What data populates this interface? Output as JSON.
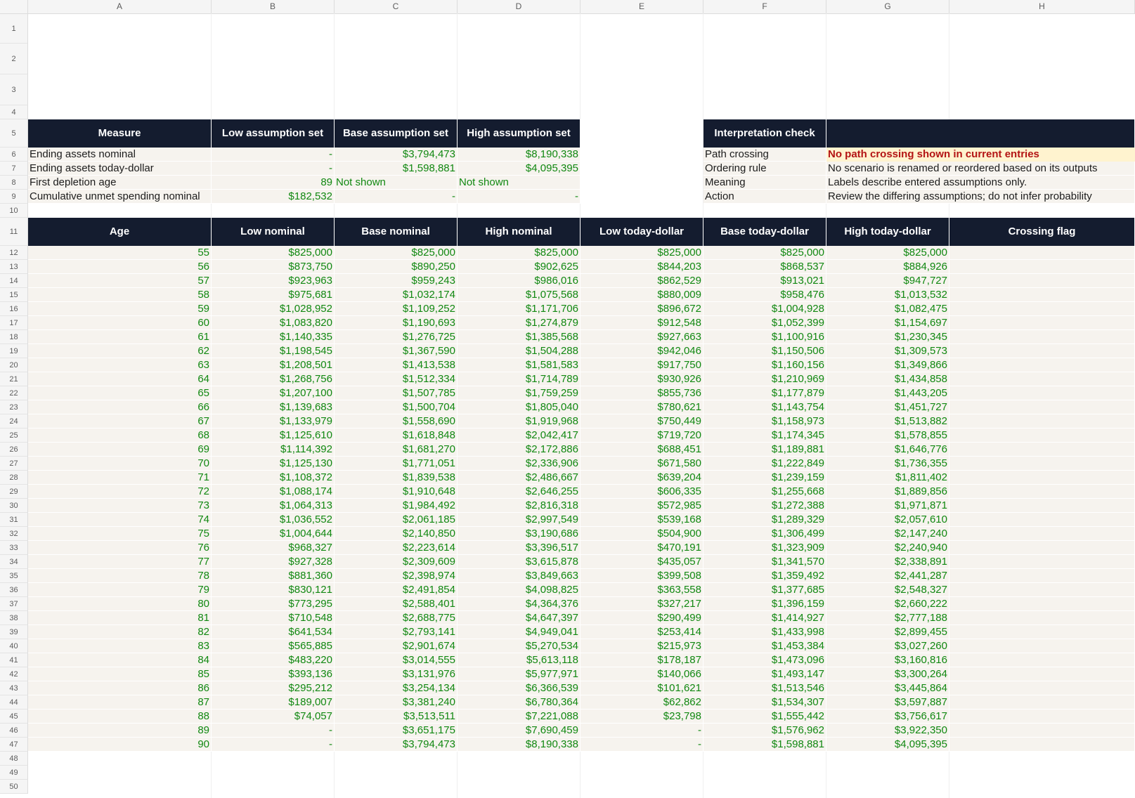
{
  "columns": [
    "A",
    "B",
    "C",
    "D",
    "E",
    "F",
    "G",
    "H"
  ],
  "row_numbers": [
    1,
    2,
    3,
    4,
    5,
    6,
    7,
    8,
    9,
    10,
    11,
    12,
    13,
    14,
    15,
    16,
    17,
    18,
    19,
    20,
    21,
    22,
    23,
    24,
    25,
    26,
    27,
    28,
    29,
    30,
    31,
    32,
    33,
    34,
    35,
    36,
    37,
    38,
    39,
    40,
    41,
    42,
    43,
    44,
    45,
    46,
    47,
    48,
    49,
    50
  ],
  "summary": {
    "headers": [
      "Measure",
      "Low assumption set",
      "Base assumption set",
      "High assumption set"
    ],
    "rows": [
      {
        "measure": "Ending assets nominal",
        "low": "-",
        "base": "$3,794,473",
        "high": "$8,190,338"
      },
      {
        "measure": "Ending assets today-dollar",
        "low": "-",
        "base": "$1,598,881",
        "high": "$4,095,395"
      },
      {
        "measure": "First depletion age",
        "low": "89",
        "base": "Not shown",
        "high": "Not shown"
      },
      {
        "measure": "Cumulative unmet spending nominal",
        "low": "$182,532",
        "base": "-",
        "high": "-"
      }
    ]
  },
  "interpretation": {
    "headers": [
      "Interpretation check",
      ""
    ],
    "rows": [
      {
        "label": "Path crossing",
        "value": "No path crossing shown in current entries"
      },
      {
        "label": "Ordering rule",
        "value": "No scenario is renamed or reordered based on its outputs"
      },
      {
        "label": "Meaning",
        "value": "Labels describe entered assumptions only."
      },
      {
        "label": "Action",
        "value": "Review the differing assumptions; do not infer probability"
      }
    ]
  },
  "paths": {
    "headers": [
      "Age",
      "Low nominal",
      "Base nominal",
      "High nominal",
      "Low today-dollar",
      "Base today-dollar",
      "High today-dollar",
      "Crossing flag"
    ],
    "rows": [
      [
        "55",
        "$825,000",
        "$825,000",
        "$825,000",
        "$825,000",
        "$825,000",
        "$825,000",
        ""
      ],
      [
        "56",
        "$873,750",
        "$890,250",
        "$902,625",
        "$844,203",
        "$868,537",
        "$884,926",
        ""
      ],
      [
        "57",
        "$923,963",
        "$959,243",
        "$986,016",
        "$862,529",
        "$913,021",
        "$947,727",
        ""
      ],
      [
        "58",
        "$975,681",
        "$1,032,174",
        "$1,075,568",
        "$880,009",
        "$958,476",
        "$1,013,532",
        ""
      ],
      [
        "59",
        "$1,028,952",
        "$1,109,252",
        "$1,171,706",
        "$896,672",
        "$1,004,928",
        "$1,082,475",
        ""
      ],
      [
        "60",
        "$1,083,820",
        "$1,190,693",
        "$1,274,879",
        "$912,548",
        "$1,052,399",
        "$1,154,697",
        ""
      ],
      [
        "61",
        "$1,140,335",
        "$1,276,725",
        "$1,385,568",
        "$927,663",
        "$1,100,916",
        "$1,230,345",
        ""
      ],
      [
        "62",
        "$1,198,545",
        "$1,367,590",
        "$1,504,288",
        "$942,046",
        "$1,150,506",
        "$1,309,573",
        ""
      ],
      [
        "63",
        "$1,208,501",
        "$1,413,538",
        "$1,581,583",
        "$917,750",
        "$1,160,156",
        "$1,349,866",
        ""
      ],
      [
        "64",
        "$1,268,756",
        "$1,512,334",
        "$1,714,789",
        "$930,926",
        "$1,210,969",
        "$1,434,858",
        ""
      ],
      [
        "65",
        "$1,207,100",
        "$1,507,785",
        "$1,759,259",
        "$855,736",
        "$1,177,879",
        "$1,443,205",
        ""
      ],
      [
        "66",
        "$1,139,683",
        "$1,500,704",
        "$1,805,040",
        "$780,621",
        "$1,143,754",
        "$1,451,727",
        ""
      ],
      [
        "67",
        "$1,133,979",
        "$1,558,690",
        "$1,919,968",
        "$750,449",
        "$1,158,973",
        "$1,513,882",
        ""
      ],
      [
        "68",
        "$1,125,610",
        "$1,618,848",
        "$2,042,417",
        "$719,720",
        "$1,174,345",
        "$1,578,855",
        ""
      ],
      [
        "69",
        "$1,114,392",
        "$1,681,270",
        "$2,172,886",
        "$688,451",
        "$1,189,881",
        "$1,646,776",
        ""
      ],
      [
        "70",
        "$1,125,130",
        "$1,771,051",
        "$2,336,906",
        "$671,580",
        "$1,222,849",
        "$1,736,355",
        ""
      ],
      [
        "71",
        "$1,108,372",
        "$1,839,538",
        "$2,486,667",
        "$639,204",
        "$1,239,159",
        "$1,811,402",
        ""
      ],
      [
        "72",
        "$1,088,174",
        "$1,910,648",
        "$2,646,255",
        "$606,335",
        "$1,255,668",
        "$1,889,856",
        ""
      ],
      [
        "73",
        "$1,064,313",
        "$1,984,492",
        "$2,816,318",
        "$572,985",
        "$1,272,388",
        "$1,971,871",
        ""
      ],
      [
        "74",
        "$1,036,552",
        "$2,061,185",
        "$2,997,549",
        "$539,168",
        "$1,289,329",
        "$2,057,610",
        ""
      ],
      [
        "75",
        "$1,004,644",
        "$2,140,850",
        "$3,190,686",
        "$504,900",
        "$1,306,499",
        "$2,147,240",
        ""
      ],
      [
        "76",
        "$968,327",
        "$2,223,614",
        "$3,396,517",
        "$470,191",
        "$1,323,909",
        "$2,240,940",
        ""
      ],
      [
        "77",
        "$927,328",
        "$2,309,609",
        "$3,615,878",
        "$435,057",
        "$1,341,570",
        "$2,338,891",
        ""
      ],
      [
        "78",
        "$881,360",
        "$2,398,974",
        "$3,849,663",
        "$399,508",
        "$1,359,492",
        "$2,441,287",
        ""
      ],
      [
        "79",
        "$830,121",
        "$2,491,854",
        "$4,098,825",
        "$363,558",
        "$1,377,685",
        "$2,548,327",
        ""
      ],
      [
        "80",
        "$773,295",
        "$2,588,401",
        "$4,364,376",
        "$327,217",
        "$1,396,159",
        "$2,660,222",
        ""
      ],
      [
        "81",
        "$710,548",
        "$2,688,775",
        "$4,647,397",
        "$290,499",
        "$1,414,927",
        "$2,777,188",
        ""
      ],
      [
        "82",
        "$641,534",
        "$2,793,141",
        "$4,949,041",
        "$253,414",
        "$1,433,998",
        "$2,899,455",
        ""
      ],
      [
        "83",
        "$565,885",
        "$2,901,674",
        "$5,270,534",
        "$215,973",
        "$1,453,384",
        "$3,027,260",
        ""
      ],
      [
        "84",
        "$483,220",
        "$3,014,555",
        "$5,613,118",
        "$178,187",
        "$1,473,096",
        "$3,160,816",
        ""
      ],
      [
        "85",
        "$393,136",
        "$3,131,976",
        "$5,977,971",
        "$140,066",
        "$1,493,147",
        "$3,300,264",
        ""
      ],
      [
        "86",
        "$295,212",
        "$3,254,134",
        "$6,366,539",
        "$101,621",
        "$1,513,546",
        "$3,445,864",
        ""
      ],
      [
        "87",
        "$189,007",
        "$3,381,240",
        "$6,780,364",
        "$62,862",
        "$1,534,307",
        "$3,597,887",
        ""
      ],
      [
        "88",
        "$74,057",
        "$3,513,511",
        "$7,221,088",
        "$23,798",
        "$1,555,442",
        "$3,756,617",
        ""
      ],
      [
        "89",
        "-",
        "$3,651,175",
        "$7,690,459",
        "-",
        "$1,576,962",
        "$3,922,350",
        ""
      ],
      [
        "90",
        "-",
        "$3,794,473",
        "$8,190,338",
        "-",
        "$1,598,881",
        "$4,095,395",
        ""
      ]
    ]
  },
  "colors": {
    "header_bg": "#141c2f",
    "body_bg": "#f6f3ee",
    "number_text": "#118811",
    "warning_bg": "#fff3cf",
    "warning_text": "#b31414"
  }
}
